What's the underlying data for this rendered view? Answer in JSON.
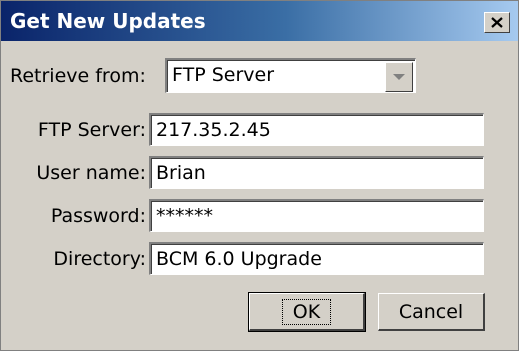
{
  "window": {
    "title": "Get New Updates",
    "close_icon": "close-icon"
  },
  "retrieve": {
    "label": "Retrieve from:",
    "selected": "FTP Server",
    "arrow_icon": "chevron-down-icon"
  },
  "fields": {
    "ftp_server": {
      "label": "FTP Server:",
      "value": "217.35.2.45"
    },
    "user_name": {
      "label": "User name:",
      "value": "Brian"
    },
    "password": {
      "label": "Password:",
      "value": "******"
    },
    "directory": {
      "label": "Directory:",
      "value": "BCM 6.0 Upgrade"
    }
  },
  "buttons": {
    "ok": "OK",
    "cancel": "Cancel"
  }
}
